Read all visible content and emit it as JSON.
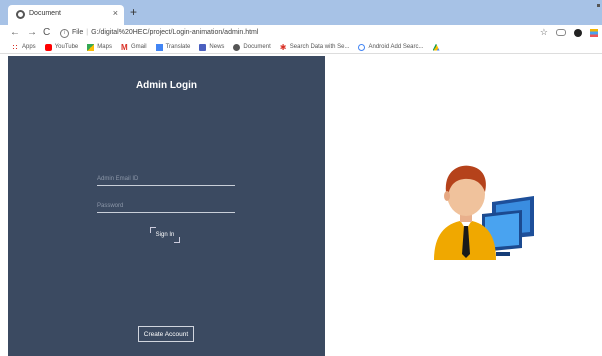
{
  "browser": {
    "tab_title": "Document",
    "tab_close": "×",
    "new_tab": "+",
    "address": {
      "scheme_label": "File",
      "url": "G:/digital%20HEC/project/Login-animation/admin.html"
    }
  },
  "bookmarks": [
    {
      "label": "Apps",
      "icon": "apps-icon",
      "color": "#d93025"
    },
    {
      "label": "YouTube",
      "icon": "youtube-icon",
      "color": "#ff0000"
    },
    {
      "label": "Maps",
      "icon": "maps-icon",
      "color": "#34a853"
    },
    {
      "label": "Gmail",
      "icon": "gmail-icon",
      "color": "#d93025"
    },
    {
      "label": "Translate",
      "icon": "translate-icon",
      "color": "#4285f4"
    },
    {
      "label": "News",
      "icon": "news-icon",
      "color": "#4a5fbf"
    },
    {
      "label": "Document",
      "icon": "globe-icon",
      "color": "#555555"
    },
    {
      "label": "Search Data with Se...",
      "icon": "bookmark-icon",
      "color": "#d93025"
    },
    {
      "label": "Android Add Searc...",
      "icon": "android-icon",
      "color": "#4285f4"
    },
    {
      "label": "",
      "icon": "drive-icon",
      "color": "#0f9d58"
    }
  ],
  "login": {
    "title": "Admin Login",
    "userid_placeholder": "Admin Email ID",
    "password_placeholder": "Password",
    "signin_label": "Sign In",
    "create_label": "Create Account",
    "panel_color": "#3b4a61"
  }
}
